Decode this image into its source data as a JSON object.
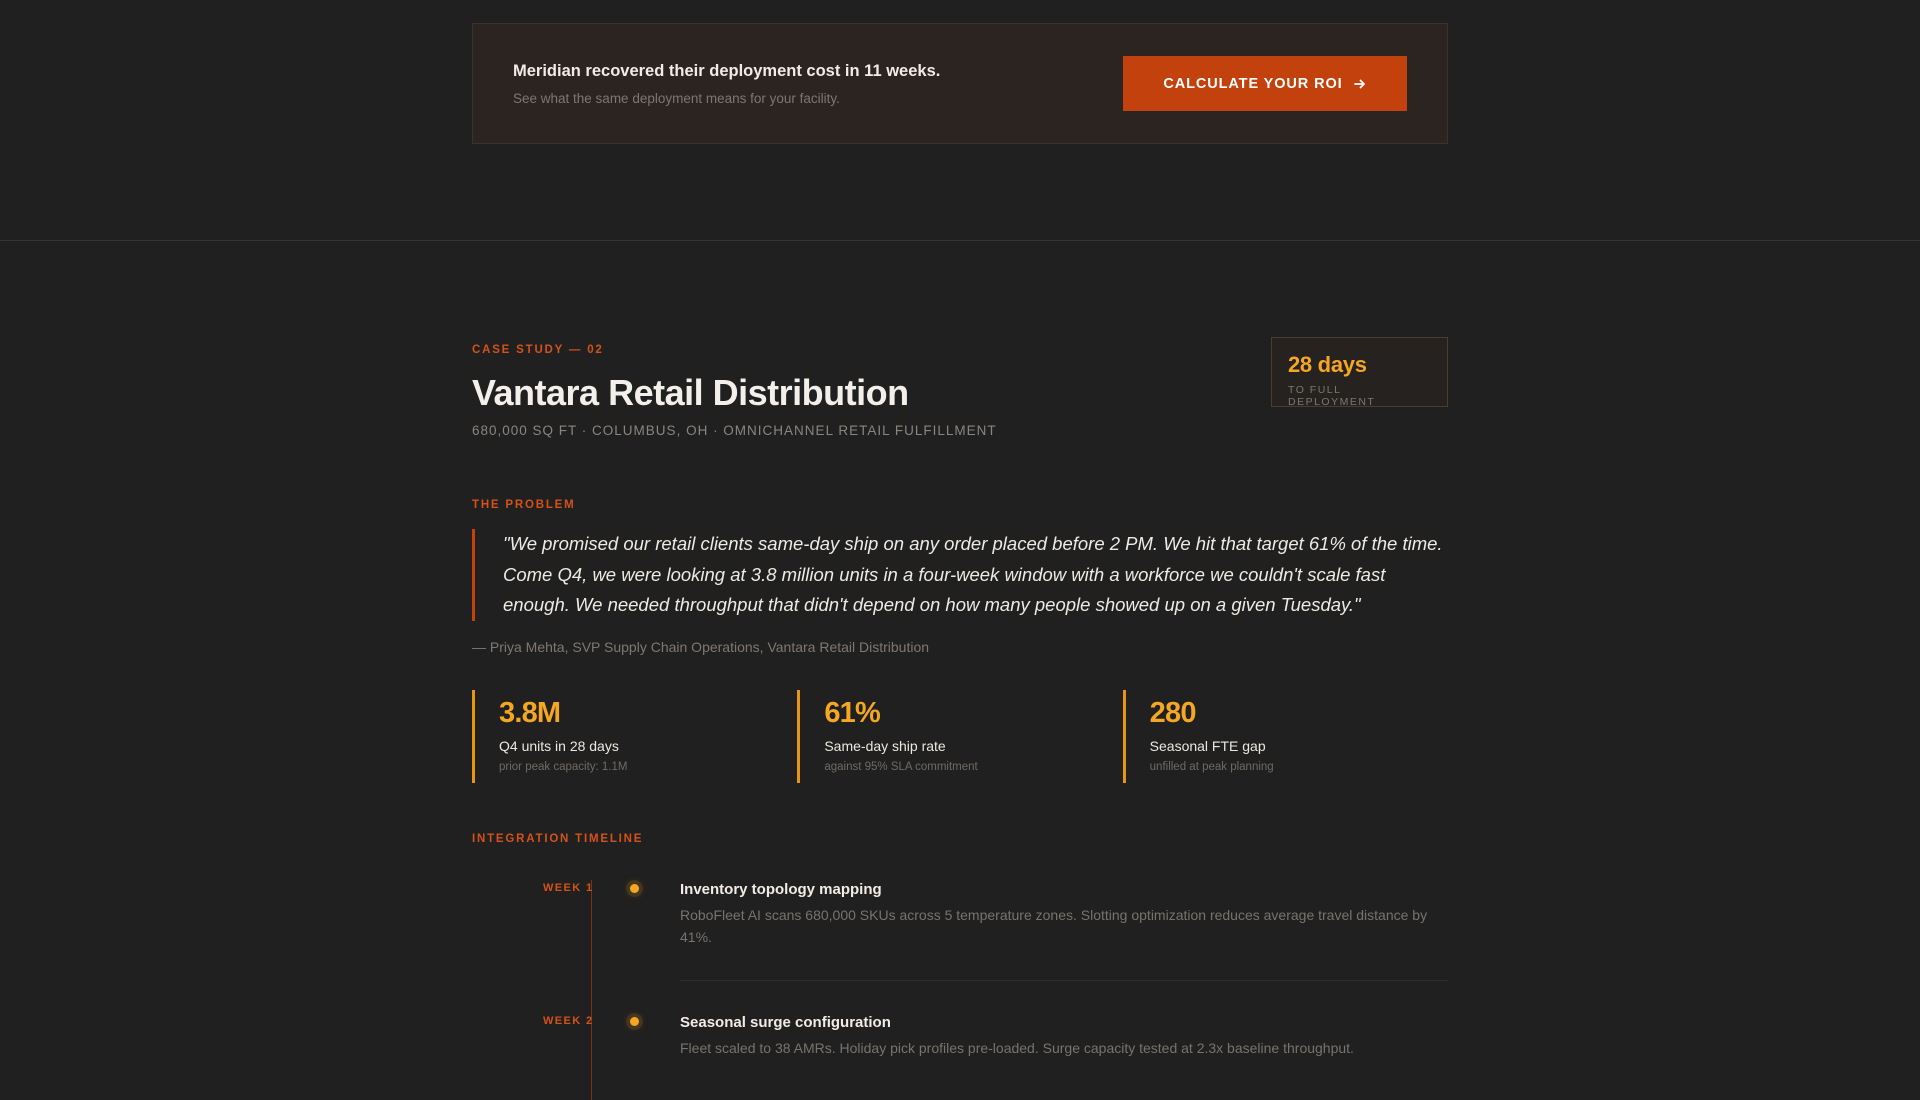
{
  "roi_banner": {
    "headline": "Meridian recovered their deployment cost in 11 weeks.",
    "subtext": "See what the same deployment means for your facility.",
    "button_label": "CALCULATE YOUR ROI",
    "button_icon": "arrow-right-icon"
  },
  "case_study": {
    "eyebrow": "CASE STUDY — 02",
    "title": "Vantara Retail Distribution",
    "meta": "680,000 SQ FT · COLUMBUS, OH · OMNICHANNEL RETAIL FULFILLMENT",
    "deploy_badge": {
      "value": "28 days",
      "label": "TO FULL DEPLOYMENT"
    }
  },
  "problem": {
    "eyebrow": "THE PROBLEM",
    "quote": "\"We promised our retail clients same-day ship on any order placed before 2 PM. We hit that target 61% of the time. Come Q4, we were looking at 3.8 million units in a four-week window with a workforce we couldn't scale fast enough. We needed throughput that didn't depend on how many people showed up on a given Tuesday.\"",
    "attribution": "— Priya Mehta, SVP Supply Chain Operations, Vantara Retail Distribution"
  },
  "stats": [
    {
      "value": "3.8M",
      "label": "Q4 units in 28 days",
      "note": "prior peak capacity: 1.1M"
    },
    {
      "value": "61%",
      "label": "Same-day ship rate",
      "note": "against 95% SLA commitment"
    },
    {
      "value": "280",
      "label": "Seasonal FTE gap",
      "note": "unfilled at peak planning"
    }
  ],
  "timeline": {
    "eyebrow": "INTEGRATION TIMELINE",
    "items": [
      {
        "week": "WEEK 1",
        "title": "Inventory topology mapping",
        "description": "RoboFleet AI scans 680,000 SKUs across 5 temperature zones. Slotting optimization reduces average travel distance by 41%."
      },
      {
        "week": "WEEK 2",
        "title": "Seasonal surge configuration",
        "description": "Fleet scaled to 38 AMRs. Holiday pick profiles pre-loaded. Surge capacity tested at 2.3x baseline throughput."
      }
    ]
  },
  "colors": {
    "background": "#202020",
    "accent_orange": "#c2410c",
    "accent_amber": "#f5a623"
  }
}
